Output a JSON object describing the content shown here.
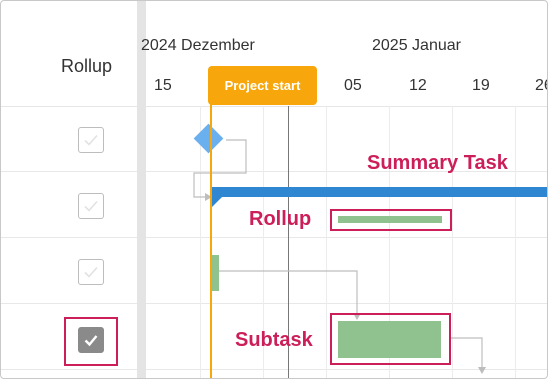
{
  "grid": {
    "column_header": "Rollup"
  },
  "rows": [
    {
      "rollup_checked": false
    },
    {
      "rollup_checked": false
    },
    {
      "rollup_checked": false
    },
    {
      "rollup_checked": true
    }
  ],
  "timeline": {
    "months": [
      "2024 Dezember",
      "2025 Januar"
    ],
    "days": [
      "15",
      "05",
      "12",
      "19",
      "26"
    ],
    "project_start_label": "Project start"
  },
  "annotations": {
    "summary_task": "Summary Task",
    "rollup": "Rollup",
    "subtask": "Subtask"
  },
  "colors": {
    "summary_bar": "#2f86d1",
    "task_bar": "#8fc28f",
    "milestone": "#6ab0ee",
    "highlight": "#cc1f5a",
    "project_start": "#f7a70b"
  }
}
